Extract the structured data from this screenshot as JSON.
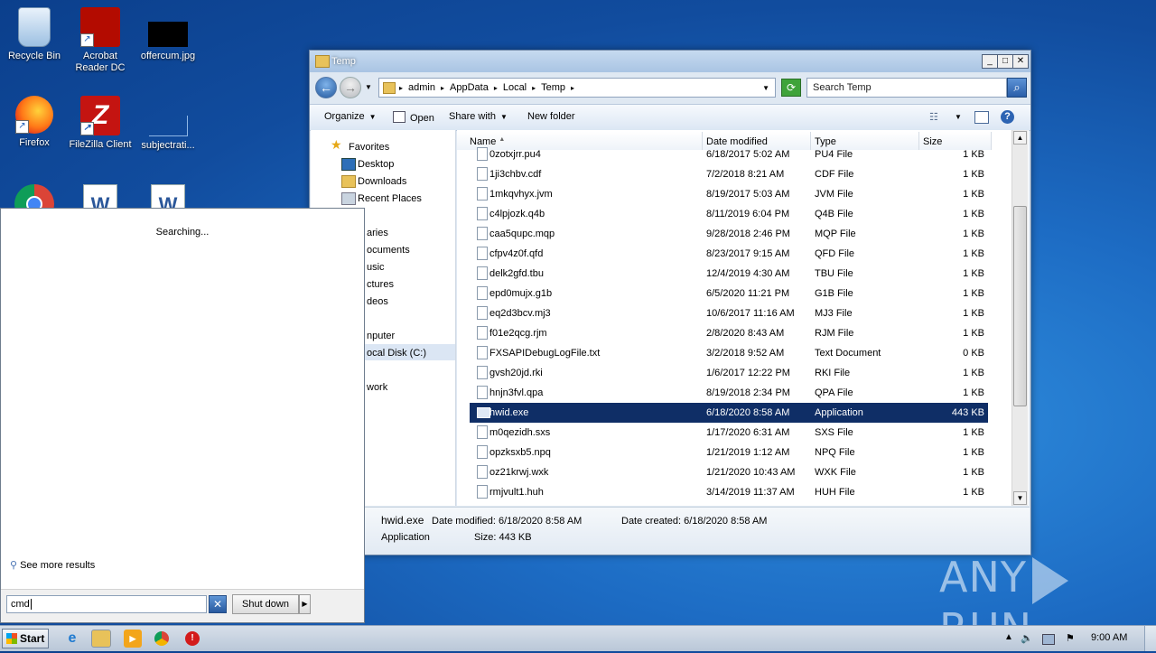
{
  "desktop": {
    "icons": [
      {
        "label": "Recycle Bin",
        "icon": "recycle-bin-icon"
      },
      {
        "label": "Acrobat Reader DC",
        "icon": "acrobat-reader-icon"
      },
      {
        "label": "offercum.jpg",
        "icon": "image-file-icon"
      },
      {
        "label": "Firefox",
        "icon": "firefox-icon"
      },
      {
        "label": "FileZilla Client",
        "icon": "filezilla-icon"
      },
      {
        "label": "subjectrati...",
        "icon": "blank-file-icon"
      }
    ]
  },
  "explorer": {
    "title": "Temp",
    "breadcrumb": [
      "admin",
      "AppData",
      "Local",
      "Temp"
    ],
    "search_placeholder": "Search Temp",
    "toolbar": {
      "organize": "Organize",
      "open": "Open",
      "share_with": "Share with",
      "new_folder": "New folder"
    },
    "nav": {
      "favorites": "Favorites",
      "desktop": "Desktop",
      "downloads": "Downloads",
      "recent_places": "Recent Places",
      "libraries": "aries",
      "documents": "ocuments",
      "music": "usic",
      "pictures": "ctures",
      "videos": "deos",
      "computer": "nputer",
      "local_disk": "ocal Disk (C:)",
      "network": "work"
    },
    "columns": {
      "name": "Name",
      "date": "Date modified",
      "type": "Type",
      "size": "Size"
    },
    "files": [
      {
        "name": "0zotxjrr.pu4",
        "date": "6/18/2017 5:02 AM",
        "type": "PU4 File",
        "size": "1 KB"
      },
      {
        "name": "1ji3chbv.cdf",
        "date": "7/2/2018 8:21 AM",
        "type": "CDF File",
        "size": "1 KB"
      },
      {
        "name": "1mkqvhyx.jvm",
        "date": "8/19/2017 5:03 AM",
        "type": "JVM File",
        "size": "1 KB"
      },
      {
        "name": "c4lpjozk.q4b",
        "date": "8/11/2019 6:04 PM",
        "type": "Q4B File",
        "size": "1 KB"
      },
      {
        "name": "caa5qupc.mqp",
        "date": "9/28/2018 2:46 PM",
        "type": "MQP File",
        "size": "1 KB"
      },
      {
        "name": "cfpv4z0f.qfd",
        "date": "8/23/2017 9:15 AM",
        "type": "QFD File",
        "size": "1 KB"
      },
      {
        "name": "delk2gfd.tbu",
        "date": "12/4/2019 4:30 AM",
        "type": "TBU File",
        "size": "1 KB"
      },
      {
        "name": "epd0mujx.g1b",
        "date": "6/5/2020 11:21 PM",
        "type": "G1B File",
        "size": "1 KB"
      },
      {
        "name": "eq2d3bcv.mj3",
        "date": "10/6/2017 11:16 AM",
        "type": "MJ3 File",
        "size": "1 KB"
      },
      {
        "name": "f01e2qcg.rjm",
        "date": "2/8/2020 8:43 AM",
        "type": "RJM File",
        "size": "1 KB"
      },
      {
        "name": "FXSAPIDebugLogFile.txt",
        "date": "3/2/2018 9:52 AM",
        "type": "Text Document",
        "size": "0 KB"
      },
      {
        "name": "gvsh20jd.rki",
        "date": "1/6/2017 12:22 PM",
        "type": "RKI File",
        "size": "1 KB"
      },
      {
        "name": "hnjn3fvl.qpa",
        "date": "8/19/2018 2:34 PM",
        "type": "QPA File",
        "size": "1 KB"
      },
      {
        "name": "hwid.exe",
        "date": "6/18/2020 8:58 AM",
        "type": "Application",
        "size": "443 KB",
        "selected": true
      },
      {
        "name": "m0qezidh.sxs",
        "date": "1/17/2020 6:31 AM",
        "type": "SXS File",
        "size": "1 KB"
      },
      {
        "name": "opzksxb5.npq",
        "date": "1/21/2019 1:12 AM",
        "type": "NPQ File",
        "size": "1 KB"
      },
      {
        "name": "oz21krwj.wxk",
        "date": "1/21/2020 10:43 AM",
        "type": "WXK File",
        "size": "1 KB"
      },
      {
        "name": "rmjvult1.huh",
        "date": "3/14/2019 11:37 AM",
        "type": "HUH File",
        "size": "1 KB"
      }
    ],
    "details": {
      "filename": "hwid.exe",
      "date_modified": "Date modified: 6/18/2020 8:58 AM",
      "date_created": "Date created: 6/18/2020 8:58 AM",
      "type": "Application",
      "size": "Size: 443 KB"
    }
  },
  "start_menu": {
    "status": "Searching...",
    "see_more": "See more results",
    "search_value": "cmd",
    "shutdown_label": "Shut down"
  },
  "taskbar": {
    "start_label": "Start",
    "clock": "9:00 AM"
  },
  "watermark": {
    "left": "ANY",
    "right": "RUN"
  },
  "colors": {
    "selection": "#0f2e66",
    "desktop": "#1d6cc4"
  }
}
